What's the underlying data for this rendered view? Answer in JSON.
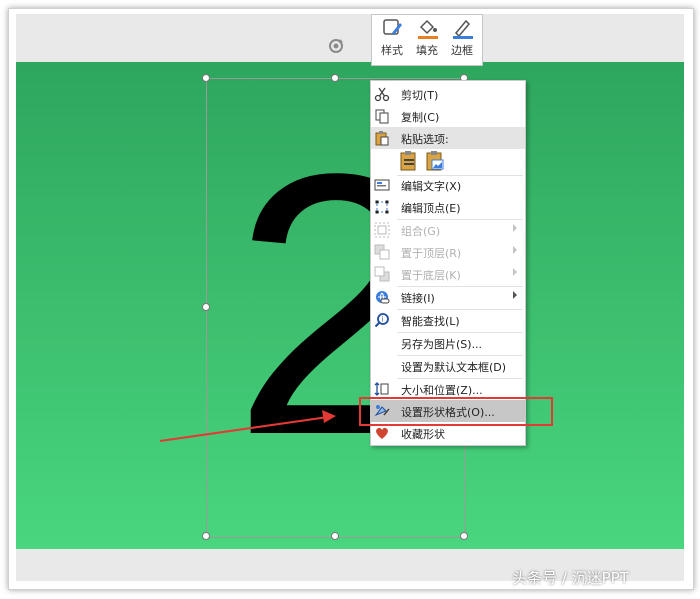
{
  "minitoolbar": {
    "style_label": "样式",
    "fill_label": "填充",
    "border_label": "边框"
  },
  "slide": {
    "shape_text": "2"
  },
  "context_menu": {
    "items": [
      {
        "label": "剪切(T)",
        "icon": "scissors-icon",
        "enabled": true
      },
      {
        "label": "复制(C)",
        "icon": "copy-icon",
        "enabled": true
      },
      {
        "label": "粘贴选项:",
        "icon": "paste-icon",
        "enabled": true
      },
      {
        "label": "编辑文字(X)",
        "icon": "edit-text-icon",
        "enabled": true
      },
      {
        "label": "编辑顶点(E)",
        "icon": "edit-points-icon",
        "enabled": true
      },
      {
        "label": "组合(G)",
        "icon": "group-icon",
        "enabled": false
      },
      {
        "label": "置于顶层(R)",
        "icon": "bring-front-icon",
        "enabled": false
      },
      {
        "label": "置于底层(K)",
        "icon": "send-back-icon",
        "enabled": false
      },
      {
        "label": "链接(I)",
        "icon": "link-icon",
        "enabled": true
      },
      {
        "label": "智能查找(L)",
        "icon": "smart-lookup-icon",
        "enabled": true
      },
      {
        "label": "另存为图片(S)...",
        "icon": "",
        "enabled": true
      },
      {
        "label": "设置为默认文本框(D)",
        "icon": "",
        "enabled": true
      },
      {
        "label": "大小和位置(Z)...",
        "icon": "size-position-icon",
        "enabled": true
      },
      {
        "label": "设置形状格式(O)...",
        "icon": "format-shape-icon",
        "enabled": true,
        "highlighted": true
      },
      {
        "label": "收藏形状",
        "icon": "heart-icon",
        "enabled": true
      }
    ]
  },
  "watermark": "头条号 / 沉迷PPT",
  "colors": {
    "slide_top": "#2ea65e",
    "slide_bottom": "#49d67e",
    "annotation_red": "#e53935",
    "fill_orange": "#e67e22"
  }
}
